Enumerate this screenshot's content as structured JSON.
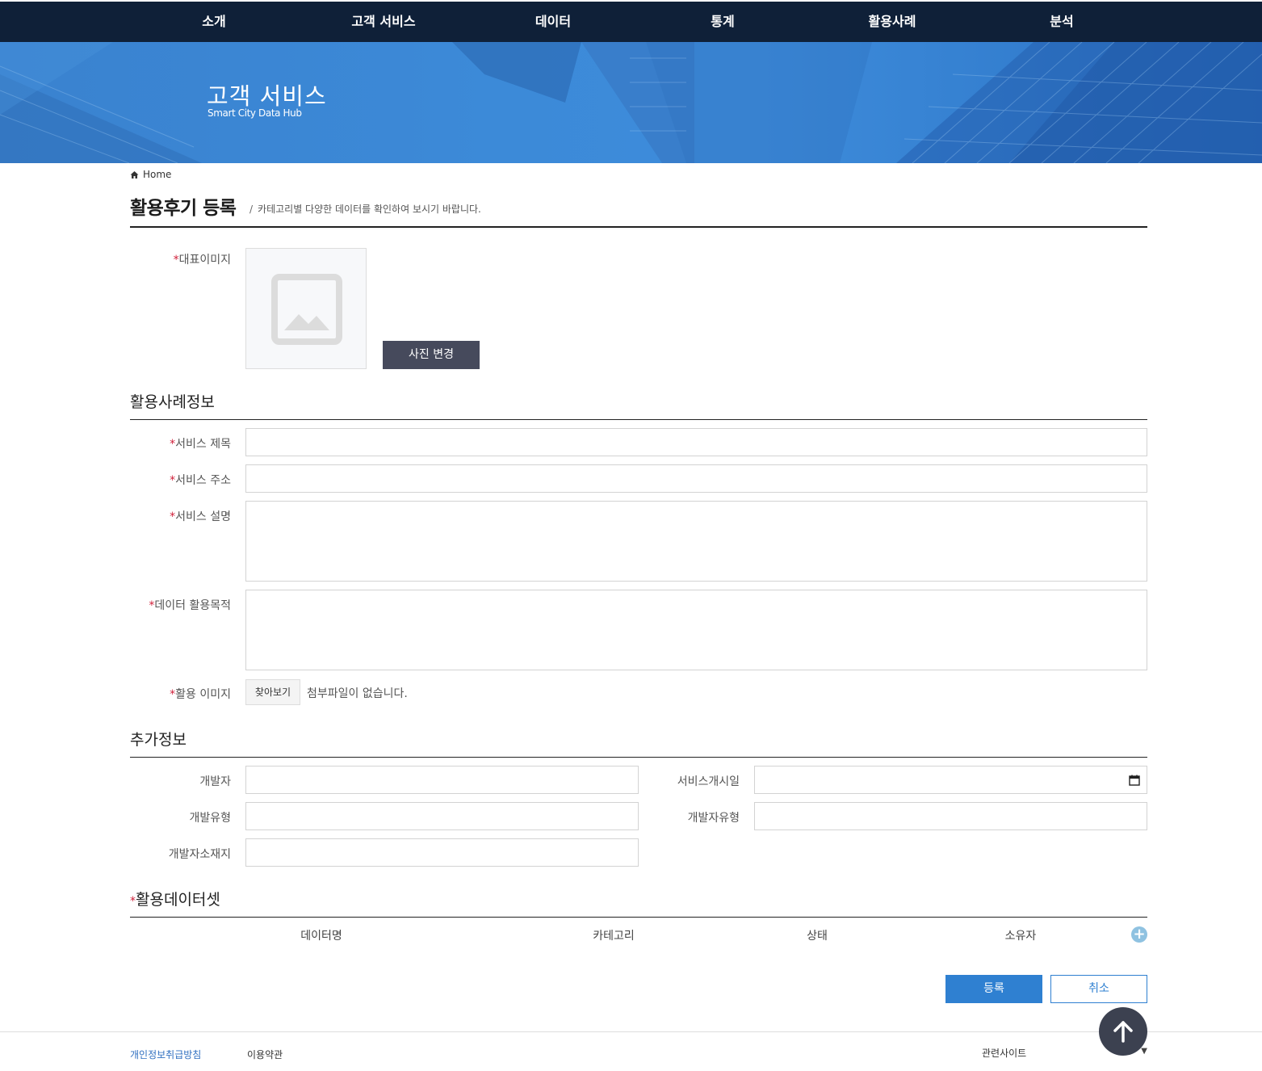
{
  "nav": {
    "items": [
      "소개",
      "고객 서비스",
      "데이터",
      "통계",
      "활용사례",
      "분석"
    ]
  },
  "hero": {
    "title": "고객 서비스",
    "subtitle": "Smart City Data Hub"
  },
  "breadcrumb": {
    "home": "Home"
  },
  "page": {
    "title": "활용후기 등록",
    "description": "카테고리별 다양한 데이터를 확인하여 보시기 바랍니다.",
    "separator": "/"
  },
  "representative_image": {
    "required_mark": "*",
    "label": "대표이미지",
    "change_button": "사진 변경"
  },
  "case_info": {
    "title": "활용사례정보",
    "fields": {
      "service_title": "서비스 제목",
      "service_address": "서비스 주소",
      "service_description": "서비스 설명",
      "data_purpose": "데이터 활용목적",
      "usage_image": "활용 이미지"
    },
    "file_button": "찾아보기",
    "file_status": "첨부파일이 없습니다."
  },
  "extra_info": {
    "title": "추가정보",
    "fields": {
      "developer": "개발자",
      "service_start_date": "서비스개시일",
      "dev_type": "개발유형",
      "developer_type": "개발자유형",
      "developer_location": "개발자소재지"
    }
  },
  "dataset": {
    "required_mark": "*",
    "title": "활용데이터셋",
    "columns": [
      "데이터명",
      "카테고리",
      "상태",
      "소유자"
    ],
    "add_symbol": "+"
  },
  "actions": {
    "submit": "등록",
    "cancel": "취소"
  },
  "footer": {
    "privacy": "개인정보취급방침",
    "terms": "이용약관",
    "related_sites": "관련사이트",
    "dropdown_arrow": "▼"
  },
  "colors": {
    "nav_bg": "#0f2038",
    "primary": "#2f80d1",
    "dark_button": "#464a5c",
    "required": "#d0203a"
  }
}
